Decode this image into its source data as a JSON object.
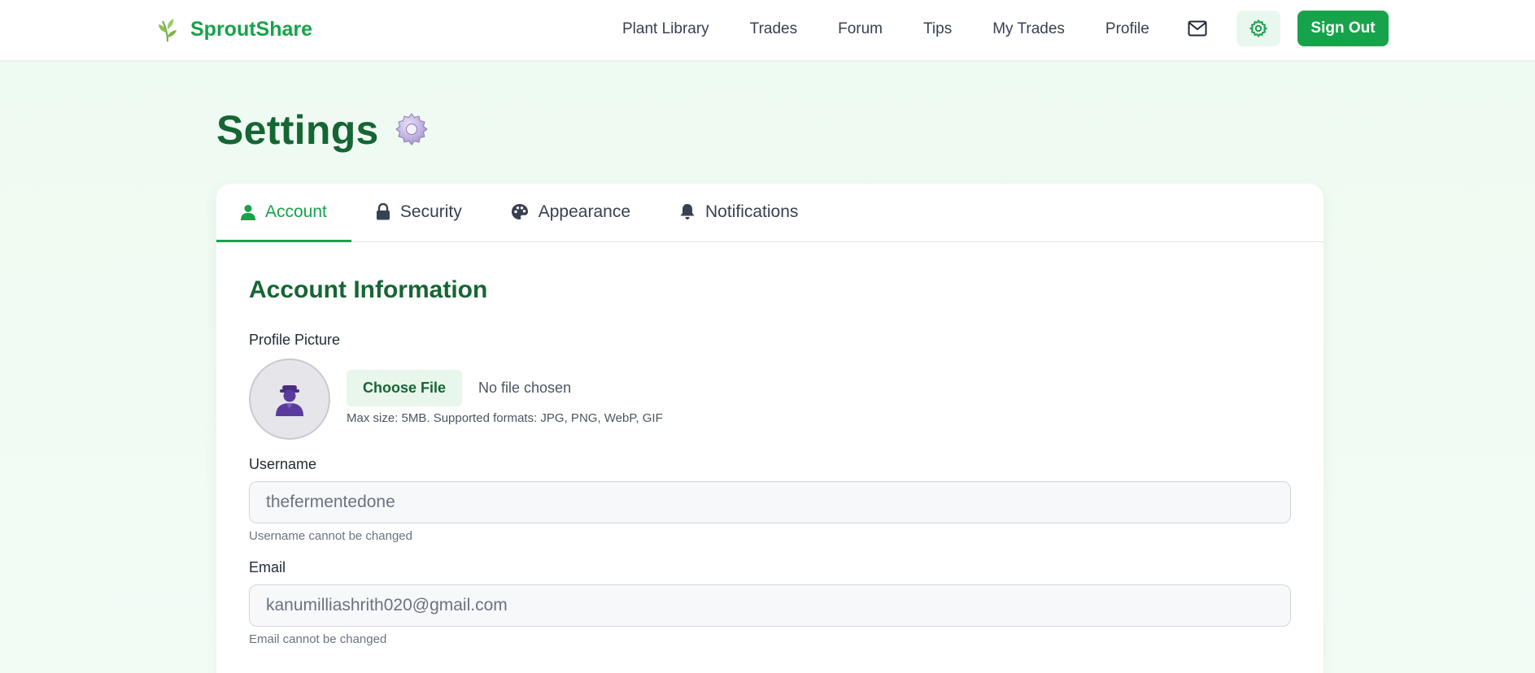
{
  "brand": {
    "name": "SproutShare",
    "logo_icon": "sprout-icon"
  },
  "nav": {
    "links": [
      "Plant Library",
      "Trades",
      "Forum",
      "Tips",
      "My Trades",
      "Profile"
    ],
    "mail_icon": "mail-icon",
    "settings_icon": "gear-icon",
    "sign_out_label": "Sign Out"
  },
  "page": {
    "title": "Settings",
    "title_emoji": "⚙️"
  },
  "tabs": [
    {
      "label": "Account",
      "icon": "user-icon",
      "active": true
    },
    {
      "label": "Security",
      "icon": "lock-icon",
      "active": false
    },
    {
      "label": "Appearance",
      "icon": "palette-icon",
      "active": false
    },
    {
      "label": "Notifications",
      "icon": "bell-icon",
      "active": false
    }
  ],
  "account": {
    "section_title": "Account Information",
    "profile_picture": {
      "label": "Profile Picture",
      "choose_file_label": "Choose File",
      "file_status": "No file chosen",
      "hint": "Max size: 5MB. Supported formats: JPG, PNG, WebP, GIF"
    },
    "username": {
      "label": "Username",
      "value": "thefermentedone",
      "hint": "Username cannot be changed"
    },
    "email": {
      "label": "Email",
      "value": "kanumilliashrith020@gmail.com",
      "hint": "Email cannot be changed"
    }
  },
  "colors": {
    "brand_green": "#16a34a",
    "heading_green": "#166534",
    "page_bg": "#eefbf1",
    "avatar_purple": "#5b3a9e"
  }
}
